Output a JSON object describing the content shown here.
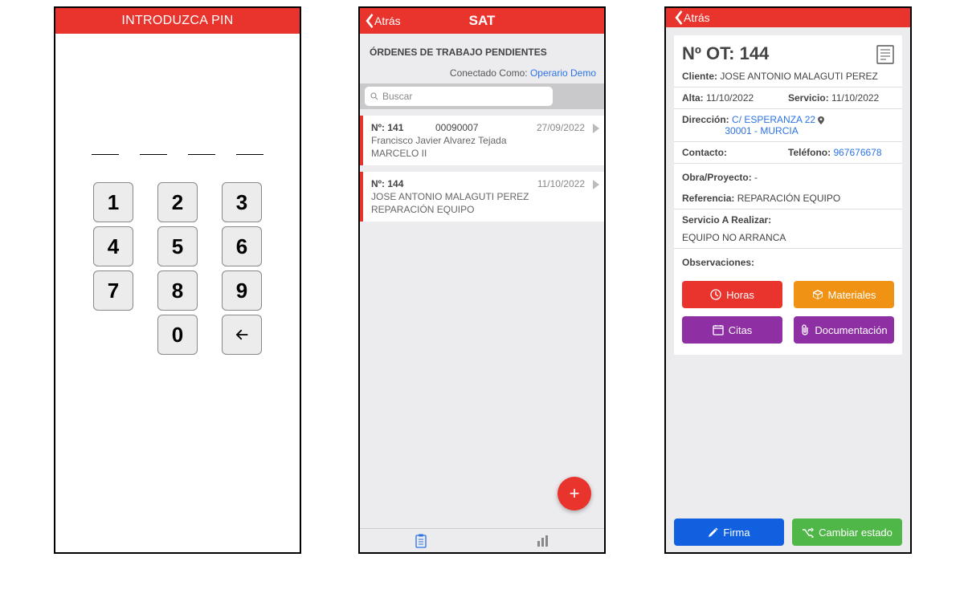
{
  "pin": {
    "header": "INTRODUZCA PIN",
    "keys": [
      "1",
      "2",
      "3",
      "4",
      "5",
      "6",
      "7",
      "8",
      "9",
      "",
      "0",
      "←"
    ]
  },
  "list": {
    "back": "Atrás",
    "title": "SAT",
    "section": "ÓRDENES DE TRABAJO PENDIENTES",
    "connected_label": "Conectado Como: ",
    "connected_user": "Operario Demo",
    "search_placeholder": "Buscar",
    "items": [
      {
        "num": "Nº: 141",
        "code": "00090007",
        "date": "27/09/2022",
        "client": "Francisco Javier Alvarez Tejada",
        "ref": "MARCELO II"
      },
      {
        "num": "Nº: 144",
        "code": "",
        "date": "11/10/2022",
        "client": "JOSE ANTONIO MALAGUTI PEREZ",
        "ref": "REPARACIÓN EQUIPO"
      }
    ],
    "fab": "+"
  },
  "detail": {
    "back": "Atrás",
    "title": "Nº OT: 144",
    "labels": {
      "cliente": "Cliente:",
      "alta": "Alta:",
      "servicio": "Servicio:",
      "direccion": "Dirección:",
      "contacto": "Contacto:",
      "telefono": "Teléfono:",
      "obra": "Obra/Proyecto:",
      "referencia": "Referencia:",
      "servicio_realizar": "Servicio A Realizar:",
      "observaciones": "Observaciones:"
    },
    "cliente": "JOSE ANTONIO MALAGUTI PEREZ",
    "alta": "11/10/2022",
    "servicio": "11/10/2022",
    "direccion_l1": "C/ ESPERANZA 22",
    "direccion_l2": "30001 - MURCIA",
    "contacto": "",
    "telefono": "967676678",
    "obra": "-",
    "referencia": "REPARACIÓN EQUIPO",
    "servicio_realizar": "EQUIPO NO ARRANCA",
    "observaciones": "",
    "buttons": {
      "horas": "Horas",
      "materiales": "Materiales",
      "citas": "Citas",
      "documentacion": "Documentación",
      "firma": "Firma",
      "cambiar": "Cambiar estado"
    }
  }
}
